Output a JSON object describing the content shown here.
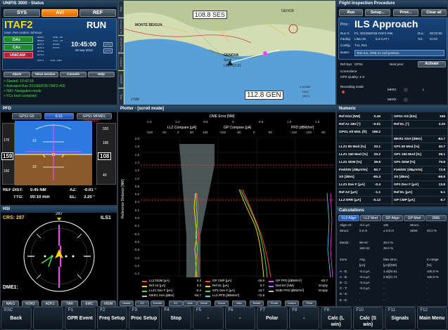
{
  "status": {
    "title": "UNIFIS 3000 - Status",
    "tabs": [
      "SYS",
      "AVI",
      "REF"
    ],
    "aircraft": "ITAF2",
    "user": "User: Pen Anders Johnson",
    "mode": "RUN",
    "sources": [
      {
        "name": "DAx",
        "color": "#2aa02a"
      },
      {
        "name": "CAx",
        "color": "#2aa02a"
      },
      {
        "name": "UNICAM",
        "color": "#c83c3c"
      }
    ],
    "clock": {
      "time": "10:45:00",
      "utc": "UTC",
      "date": "26 sep 2013",
      "zone": "UTC"
    },
    "nav_rows": [
      "NAV1",
      "NAV2",
      "ADF1",
      "ADF2",
      "GPS1",
      "GPS2",
      "VHF1"
    ],
    "freq": [
      "108.30",
      "113.70",
      "0330",
      "0310",
      "",
      "",
      "130.190"
    ],
    "actions": [
      "Alarm",
      "Voice service",
      "Console",
      "Help"
    ],
    "log": [
      "> Started: 10:42:18",
      "> Activated Run 20130EP28-ITAF2-#06",
      "> IMU: Navigation mode",
      "> FCx boot complete!"
    ]
  },
  "map": {
    "vtabs": [
      "Map",
      "Ground Trk",
      "SPCD/PRC",
      "Control",
      "DeMAP",
      "Test"
    ],
    "labels": {
      "top_left": "MONTE BEIGUA",
      "top_center": "108.8 SES",
      "top_right": "GENOA",
      "city": "GENOVA",
      "sub": "Sesti",
      "sub2": "LIMJ 13-01",
      "dme": "112.8 GEN",
      "ref1": "ILS/DME",
      "ref2": "LIMJ",
      "ref3": "(4DT)",
      "scale": "2 NM"
    }
  },
  "fip": {
    "title": "Flight Inspection Procedure",
    "buttons": [
      "Run",
      "Setup...",
      "Print...",
      "Clear all"
    ],
    "proc_label": "Proc.:",
    "proc": "ILS Approach",
    "run_label": "Run #:",
    "run": "P1: 2013SEP28-ITAF2-#06",
    "dur_label": "Dur.:",
    "dur": "00:02:50",
    "facility_label": "Facility:",
    "facility": "LIMJ 29",
    "facility_type": "ILS CAT I",
    "tol_label": "Tol.:",
    "tol": "ICAO",
    "config_label": "Config.:",
    "config": "Tx1, Rx1",
    "notes_label": "Notes:",
    "notes": "Test ILS, ORB on roof position",
    "ref_sys_label": "Ref Sys:",
    "ref_sys": "GPS1",
    "next_proc_label": "Next proc:",
    "next_proc": "Activate",
    "corrections_label": "Corrections:",
    "gps_quality_label": "GPS Quality: 1-X",
    "rec_label": "Recording mode",
    "mkr": [
      "MKR1",
      "MKR2"
    ],
    "mkr_flags": [
      "L",
      "M",
      "O"
    ]
  },
  "pfd": {
    "title": "PFD",
    "buttons": [
      "GPS1 G5",
      "ILS1",
      "GPS1 MFMDL"
    ],
    "speed": "159",
    "alt": "108",
    "qnh": "QNH 1013",
    "ref_dist_label": "REF DIST:",
    "ref_dist": "0.45 NM",
    "ttg_label": "TTG:",
    "ttg": "00:10 min",
    "az_label": "AZ:",
    "az": "-0.01 °",
    "el_label": "EL:",
    "el": "3.20 °",
    "pitch_top": "10",
    "pitch_bot": "10",
    "alt_tape": [
      "320",
      "180",
      "40"
    ],
    "spd_tape": [
      "170",
      "150"
    ]
  },
  "hsi": {
    "title": "HSI",
    "crs_label": "CRS:",
    "crs": "287",
    "source": "ILS1",
    "dme_label": "DME1:",
    "heading": "287",
    "buttons": [
      "NAV1",
      "VOR2",
      "ADF1",
      "TAR",
      "EMC",
      "VIEW"
    ]
  },
  "plotter": {
    "title": "Plotter - [scroll mode]",
    "top_axis": "DME Error  [NM]",
    "top_ticks": [
      "-1.5",
      "-1.0",
      "-0.5",
      "0",
      "0.5",
      "1.0",
      "1.5"
    ],
    "sub_axes": [
      "LLZ Compare  [μA]",
      "GP Compare  [μA]",
      "PFD [dBW/m²]"
    ],
    "sub_ticks1": [
      "-100",
      "-50",
      "0",
      "50",
      "100"
    ],
    "sub_ticks2": [
      "-100",
      "-50",
      "0",
      "50"
    ],
    "sub_ticks3": [
      "-150",
      "-100",
      "-50"
    ],
    "y_label": "Reference Distance  [NM]",
    "y_ticks": [
      "2.0",
      "1.8",
      "1.6",
      "1.4",
      "1.2",
      "1.0",
      "0.8",
      "0.6",
      "0.4",
      "0.2",
      "0.0",
      "-0.2",
      "-0.4",
      "-0.6",
      "-0.8",
      "-1.0",
      "-1.2",
      "-1.4"
    ],
    "legend": [
      {
        "name": "LLZ DDM [μA]",
        "val": "0.3",
        "color": "#ff4040"
      },
      {
        "name": "Ref AZ [μA]",
        "val": "0.3",
        "color": "#ffd800"
      },
      {
        "name": "LLZ1 Dev F [μA]",
        "val": "-0.4",
        "color": "#48e048"
      },
      {
        "name": "MKR1 SSA [dBm]",
        "val": "-84.7",
        "color": "#c0c0c0"
      },
      {
        "name": "GP CMP [μA]",
        "val": "-19.9",
        "color": "#ff4040"
      },
      {
        "name": "Ref EL [μA]",
        "val": "3.7",
        "color": "#ffd800"
      },
      {
        "name": "GP1 Dev F [μA]",
        "val": "13.7",
        "color": "#48e048"
      },
      {
        "name": "LLZ PFD [dBW/m²]",
        "val": "-72.9",
        "color": "#40e0f0"
      },
      {
        "name": "GP PFD [dBW/m²]",
        "val": "-83.7",
        "color": "#ff40ff"
      },
      {
        "name": "Dist Err [NM]",
        "val": "Empty",
        "color": "#8080ff"
      },
      {
        "name": "DME PFD [dBW/m²]",
        "val": "Empty",
        "color": "#c0c0c0"
      }
    ],
    "footer": [
      "Holder",
      "1/2",
      "Events",
      "E1",
      "Axis",
      "Scroll",
      "Zoom",
      "Max",
      "Reset",
      "Fonts",
      "Cursor",
      "Print"
    ]
  },
  "numeric": {
    "title": "Numeric",
    "rows": [
      [
        "Ref Dist [NM]",
        "0.45",
        "GPS1 GS [kts]",
        "155"
      ],
      [
        "Ref Az 180 [°]",
        "-0.01",
        "Ref EL [°]",
        "3.20"
      ],
      [
        "GPS1 Alt MSL [ft]",
        "198.2",
        "",
        ""
      ],
      [
        "",
        "",
        "MKR1 SSA [dBm]",
        "-84.7"
      ],
      [
        "LLZ1 90 Mod [%]",
        "20.1",
        "GP1 90 Mod [%]",
        "40.7"
      ],
      [
        "LLZ1 150 Mod [%]",
        "20.2",
        "GP1 150 Mod [%]",
        "39.1"
      ],
      [
        "LLZ1 SDM [%]",
        "39.8",
        "GP1 SDM [%]",
        "79.8"
      ],
      [
        "FieldStr [dBμV/m]",
        "82.7",
        "FieldStr [dBμV/m]",
        "72.8"
      ],
      [
        "SS [dBm]",
        "-65.4",
        "SS [dBm]",
        "-68.8"
      ],
      [
        "LLZ1 Dev F [μA]",
        "-0.4",
        "GP1 Dev F [μA]",
        "13.8"
      ],
      [
        "Ref AZ [μA]",
        "-1.1",
        "Ref EL [μA]",
        "5.1"
      ],
      [
        "LLZ ERR [μA]",
        "-0.12",
        "GP CMP [μA]",
        "8.7"
      ]
    ]
  },
  "calc": {
    "title": "Calculations",
    "tabs": [
      "LLZ Align",
      "LLZ Mod",
      "GP Align",
      "GP Mod",
      "DME"
    ],
    "rows": [
      [
        "Align err:",
        "-0.1 μA",
        "±0s",
        "Struct..",
        "-"
      ],
      [
        "Struct:",
        "0.0 m",
        "± 0.0 m",
        "SDM:",
        "40.0 %"
      ],
      [
        "",
        "",
        "",
        "",
        ""
      ],
      [
        "Modul.:",
        "90 Hz:",
        "20.0 %",
        "",
        ""
      ],
      [
        "",
        "150 Hz:",
        "20.0 %",
        "",
        ""
      ],
      [
        "",
        "",
        "",
        "",
        ""
      ],
      [
        "Zone",
        "Avg.",
        "Max struc.",
        "",
        "In range"
      ],
      [
        "",
        "[μA]",
        "[μA]/[NM]",
        "",
        "[%]"
      ],
      [
        "A - B:",
        "-0.4 μA",
        "1.4@0.61",
        "",
        "100.0 %"
      ],
      [
        "A - B:",
        "-0.4 μA",
        "2.9@1.71",
        "",
        "100.0 %"
      ],
      [
        "B - C:",
        "-0.3 μA",
        "-",
        "",
        "-"
      ],
      [
        "C - T:",
        "-0.3 μA",
        "-",
        "",
        "-"
      ],
      [
        "D - E:",
        "-",
        "-",
        "",
        "-"
      ],
      [
        "E - E:",
        "-",
        "-",
        "",
        "-"
      ]
    ]
  },
  "fkeys": [
    {
      "key": "ESC",
      "label": "Back",
      "dim": false
    },
    {
      "key": "",
      "label": "",
      "dim": true
    },
    {
      "key": "F1",
      "label": "OPR Event",
      "dim": false
    },
    {
      "key": "F2",
      "label": "Freq Setup",
      "dim": false
    },
    {
      "key": "F3",
      "label": "Proc Setup",
      "dim": false
    },
    {
      "key": "F4",
      "label": "Stop",
      "dim": false
    },
    {
      "key": "F5",
      "label": "-",
      "dim": false
    },
    {
      "key": "F6",
      "label": "-",
      "dim": false
    },
    {
      "key": "F7",
      "label": "Polar",
      "dim": false
    },
    {
      "key": "F8",
      "label": "-",
      "dim": false
    },
    {
      "key": "F9",
      "label": "Calc (L win)",
      "dim": false
    },
    {
      "key": "F10",
      "label": "Calc (S win)",
      "dim": false
    },
    {
      "key": "F11",
      "label": "Signals",
      "dim": false
    },
    {
      "key": "F12",
      "label": "Main Menu",
      "dim": false
    }
  ],
  "colors": {
    "accent": "#ff8a1c",
    "run": "#ffffff",
    "blue_panel": "#1a4d8a"
  }
}
